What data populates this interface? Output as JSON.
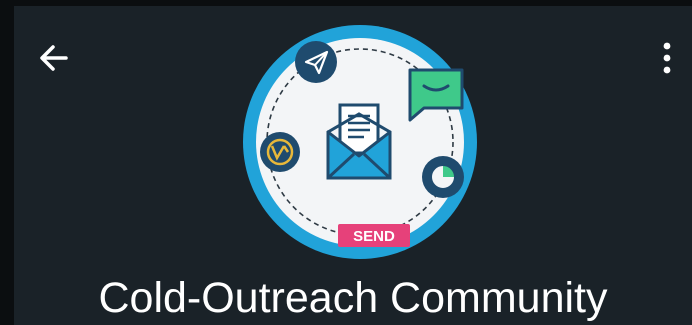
{
  "toolbar": {
    "back_icon": "arrow-left-icon",
    "menu_icon": "more-vertical-icon"
  },
  "group": {
    "avatar": {
      "center_icon": "envelope-letter-icon",
      "orbit_icons": [
        "paper-plane-icon",
        "chat-bubble-icon",
        "pie-chart-icon",
        "globe-icon"
      ],
      "badge_text": "SEND",
      "ring_color": "#21a3d9",
      "badge_color": "#e6417a",
      "bubble_color": "#3fc98a"
    },
    "name": "Cold-Outreach Community"
  },
  "colors": {
    "background": "#1a2228",
    "text": "#ffffff",
    "icon_dark": "#1f4b6e"
  }
}
